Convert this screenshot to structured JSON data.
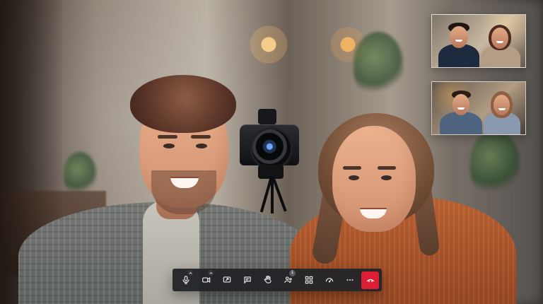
{
  "toolbar": {
    "participants_badge": "1",
    "icons": [
      "microphone-icon",
      "chevron-up-icon",
      "camera-icon",
      "chevron-up-icon",
      "share-screen-icon",
      "chat-icon",
      "raise-hand-icon",
      "participants-icon",
      "layout-grid-icon",
      "meeting-stats-icon",
      "more-icon",
      "hang-up-icon"
    ]
  },
  "colors": {
    "toolbar_bg": "#232428",
    "hangup_red": "#dc1f37",
    "icon_white": "#e8e8ea"
  }
}
